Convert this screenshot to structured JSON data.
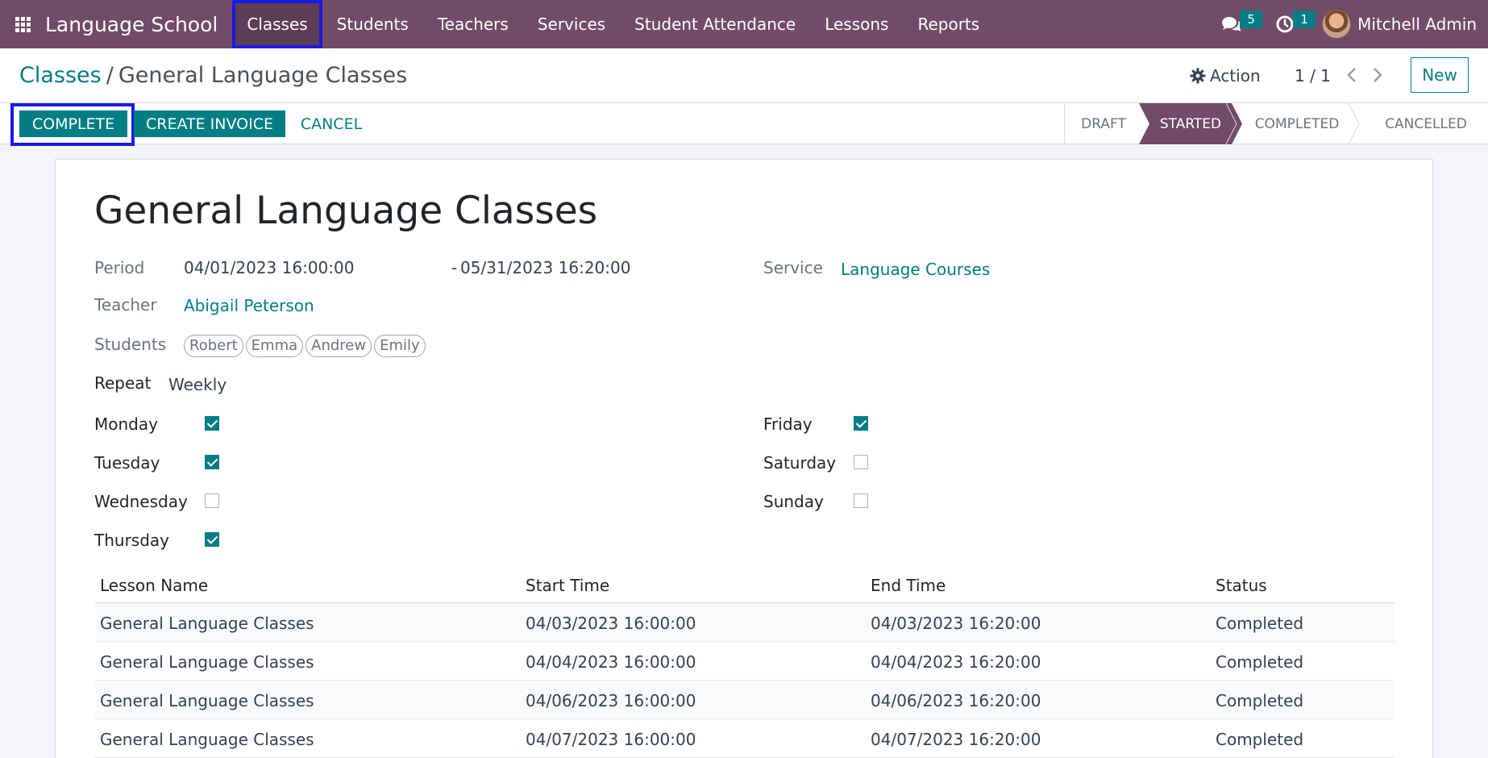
{
  "navbar": {
    "apps_icon": "apps-grid-icon",
    "brand": "Language School",
    "menu": [
      "Classes",
      "Students",
      "Teachers",
      "Services",
      "Student Attendance",
      "Lessons",
      "Reports"
    ],
    "messages_icon": "chat-icon",
    "messages_count": "5",
    "activities_icon": "clock-icon",
    "activities_count": "1",
    "user_name": "Mitchell Admin"
  },
  "control": {
    "breadcrumb_root": "Classes",
    "breadcrumb_sep": "/",
    "breadcrumb_current": "General Language Classes",
    "action_label": "Action",
    "pager": "1 / 1",
    "new_label": "New"
  },
  "statusbar": {
    "buttons": {
      "complete": "COMPLETE",
      "invoice": "CREATE INVOICE",
      "cancel": "CANCEL"
    },
    "stages": [
      "DRAFT",
      "STARTED",
      "COMPLETED",
      "CANCELLED"
    ],
    "current_stage": "STARTED"
  },
  "form": {
    "title": "General Language Classes",
    "period_label": "Period",
    "period_start": "04/01/2023 16:00:00",
    "period_end": "05/31/2023 16:20:00",
    "period_dash": "-",
    "service_label": "Service",
    "service_value": "Language Courses",
    "teacher_label": "Teacher",
    "teacher_value": "Abigail Peterson",
    "students_label": "Students",
    "students": [
      "Robert",
      "Emma",
      "Andrew",
      "Emily"
    ],
    "repeat_label": "Repeat",
    "repeat_value": "Weekly",
    "days": {
      "monday": {
        "label": "Monday",
        "checked": true
      },
      "tuesday": {
        "label": "Tuesday",
        "checked": true
      },
      "wednesday": {
        "label": "Wednesday",
        "checked": false
      },
      "thursday": {
        "label": "Thursday",
        "checked": true
      },
      "friday": {
        "label": "Friday",
        "checked": true
      },
      "saturday": {
        "label": "Saturday",
        "checked": false
      },
      "sunday": {
        "label": "Sunday",
        "checked": false
      }
    }
  },
  "lessons": {
    "columns": [
      "Lesson Name",
      "Start Time",
      "End Time",
      "Status"
    ],
    "rows": [
      [
        "General Language Classes",
        "04/03/2023 16:00:00",
        "04/03/2023 16:20:00",
        "Completed"
      ],
      [
        "General Language Classes",
        "04/04/2023 16:00:00",
        "04/04/2023 16:20:00",
        "Completed"
      ],
      [
        "General Language Classes",
        "04/06/2023 16:00:00",
        "04/06/2023 16:20:00",
        "Completed"
      ],
      [
        "General Language Classes",
        "04/07/2023 16:00:00",
        "04/07/2023 16:20:00",
        "Completed"
      ]
    ]
  },
  "colors": {
    "navbar": "#714b67",
    "accent": "#017e84",
    "highlight": "#1a1ae6"
  }
}
